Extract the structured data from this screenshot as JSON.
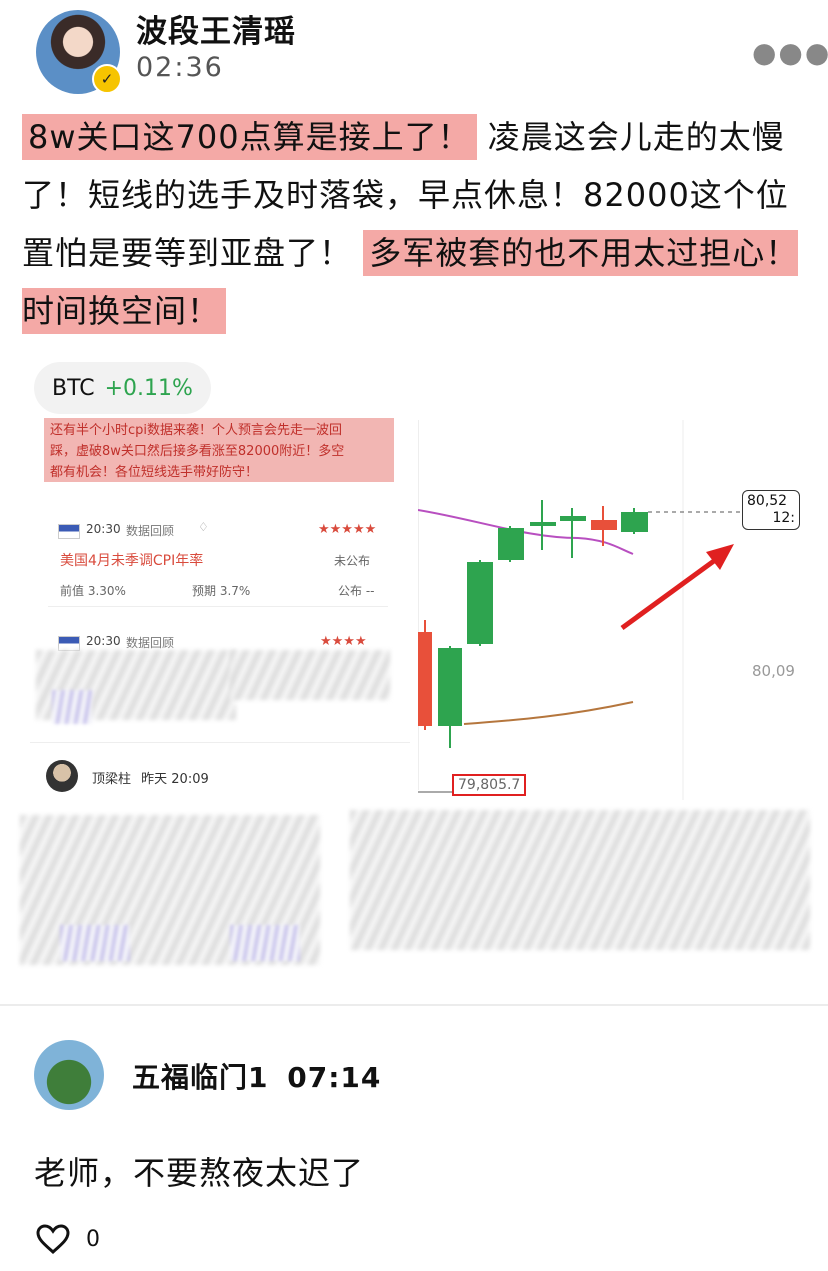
{
  "post": {
    "author": "波段王清瑶",
    "time": "02:36",
    "segments": [
      {
        "text": "8w关口这700点算是接上了！",
        "highlight": true
      },
      {
        "text": "凌晨这会儿走的太慢了！短线的选手及时落袋，早点休息！82000这个位置怕是要等到亚盘了！",
        "highlight": false
      },
      {
        "text": "多军被套的也不用太过担心！时间换空间！",
        "highlight": true
      }
    ],
    "ticker": {
      "symbol": "BTC",
      "change": "+0.11%"
    }
  },
  "embedded": {
    "banner_lines": [
      "还有半个小时cpi数据来袭！个人预言会先走一波回",
      "踩，虚破8w关口然后接多看涨至82000附近！多空",
      "都有机会！各位短线选手带好防守！"
    ],
    "event1": {
      "time": "20:30",
      "tag": "数据回顾",
      "stars": "★★★★★",
      "title": "美国4月未季调CPI年率",
      "status": "未公布",
      "prev": "前值 3.30%",
      "forecast": "预期 3.7%",
      "actual_label": "公布 --"
    },
    "event2": {
      "time": "20:30",
      "tag": "数据回顾",
      "stars": "★★★★"
    },
    "commenter": {
      "name": "顶梁柱",
      "time": "昨天 20:09"
    },
    "price_top": "80,52",
    "price_top_sub": "12:",
    "price_mid": "80,09",
    "price_low": "79,805.7"
  },
  "comment": {
    "name": "五福临门1",
    "time": "07:14",
    "text": "老师，不要熬夜太迟了",
    "likes": "0"
  },
  "colors": {
    "highlight": "#f4a9a6",
    "up": "#2ea44f",
    "down": "#e8503a"
  }
}
